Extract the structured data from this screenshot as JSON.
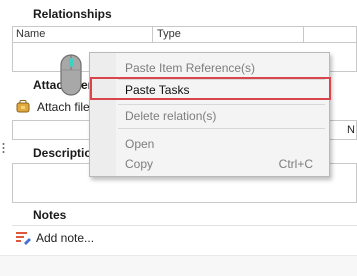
{
  "relationships": {
    "title": "Relationships",
    "columns": [
      "Name",
      "Type"
    ]
  },
  "attachments": {
    "title": "Attachments",
    "attach_label": "Attach file...",
    "right_col_hint": "N"
  },
  "description": {
    "title": "Description"
  },
  "notes": {
    "title": "Notes",
    "add_label": "Add note..."
  },
  "context_menu": {
    "items": [
      {
        "label": "Paste Item Reference(s)",
        "enabled": false
      },
      {
        "label": "Paste Tasks",
        "enabled": true,
        "highlighted": true
      },
      {
        "label": "Delete relation(s)",
        "enabled": false
      },
      {
        "label": "Open",
        "enabled": false
      },
      {
        "label": "Copy",
        "shortcut": "Ctrl+C",
        "enabled": false
      }
    ]
  },
  "colors": {
    "highlight_border": "#d9454c",
    "cursor_accent": "#3bd1c5"
  }
}
